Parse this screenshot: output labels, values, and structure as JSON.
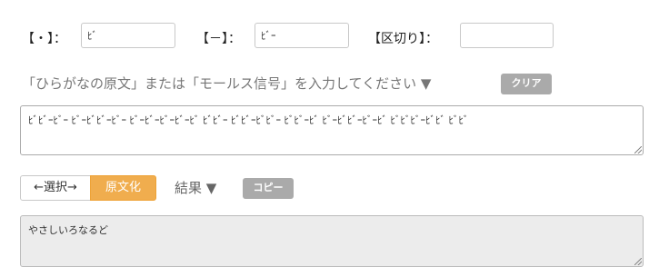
{
  "settings": {
    "dot_label": "【・】：",
    "dot_value": "ﾋﾞ",
    "dash_label": "【－】：",
    "dash_value": "ﾋﾞｰ",
    "sep_label": "【区切り】：",
    "sep_value": ""
  },
  "input_section": {
    "hint": "「ひらがなの原文」または「モールス信号」を入力してください ▼",
    "clear_label": "クリア",
    "text": "ﾋﾞﾋﾞｰﾋﾞｰ ﾋﾞｰﾋﾞﾋﾞｰﾋﾞｰ ﾋﾞｰﾋﾞｰﾋﾞｰﾋﾞｰﾋﾞ ﾋﾞﾋﾞｰ ﾋﾞﾋﾞｰﾋﾞﾋﾞｰ ﾋﾞﾋﾞｰﾋﾞ ﾋﾞｰﾋﾞﾋﾞｰﾋﾞｰﾋﾞ ﾋﾞﾋﾞﾋﾞｰﾋﾞﾋﾞ ﾋﾞﾋﾞ"
  },
  "mode": {
    "select_label": "←選択→",
    "active_label": "原文化"
  },
  "result_section": {
    "label": "結果 ▼",
    "copy_label": "コピー",
    "text": "やさしいろなるど"
  }
}
